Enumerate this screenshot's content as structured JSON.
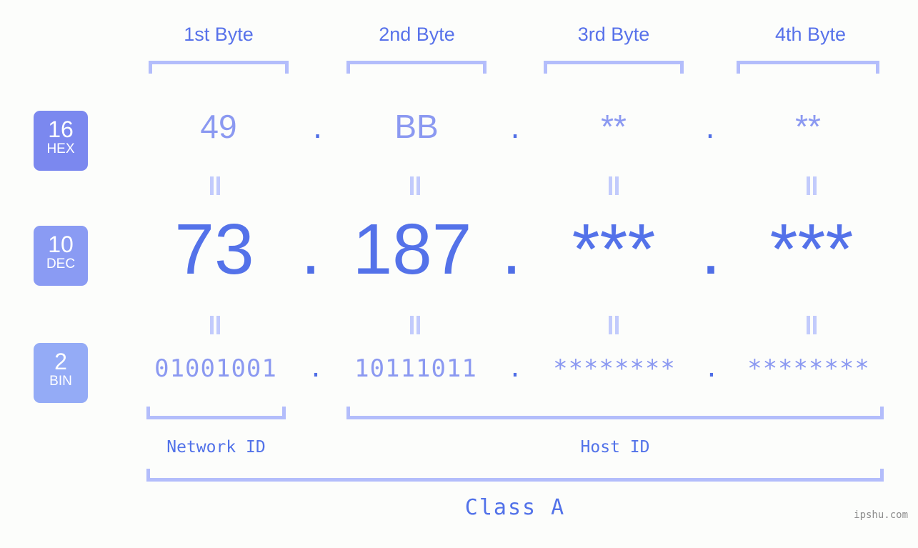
{
  "watermark": "ipshu.com",
  "byte_headers": [
    {
      "label": "1st Byte"
    },
    {
      "label": "2nd Byte"
    },
    {
      "label": "3rd Byte"
    },
    {
      "label": "4th Byte"
    }
  ],
  "radix_badges": [
    {
      "number": "16",
      "abbr": "HEX",
      "color": "#7b88ef"
    },
    {
      "number": "10",
      "abbr": "DEC",
      "color": "#8a9bf3"
    },
    {
      "number": "2",
      "abbr": "BIN",
      "color": "#94abf6"
    }
  ],
  "separator": ".",
  "rows": {
    "hex": {
      "radix": "16",
      "name": "HEX",
      "octets": [
        "49",
        "BB",
        "**",
        "**"
      ]
    },
    "dec": {
      "radix": "10",
      "name": "DEC",
      "octets": [
        "73",
        "187",
        "***",
        "***"
      ]
    },
    "bin": {
      "radix": "2",
      "name": "BIN",
      "octets": [
        "01001001",
        "10111011",
        "********",
        "********"
      ]
    }
  },
  "equality_symbol": "=",
  "sections": {
    "network_id": "Network ID",
    "host_id": "Host ID",
    "class": "Class A"
  },
  "colors": {
    "background": "#fcfdfb",
    "accent_dark": "#5272e9",
    "accent_mid": "#8b99f1",
    "accent_light": "#b3bdfb",
    "eq_mark": "#c2cbfc",
    "watermark": "#8d8d8d"
  }
}
